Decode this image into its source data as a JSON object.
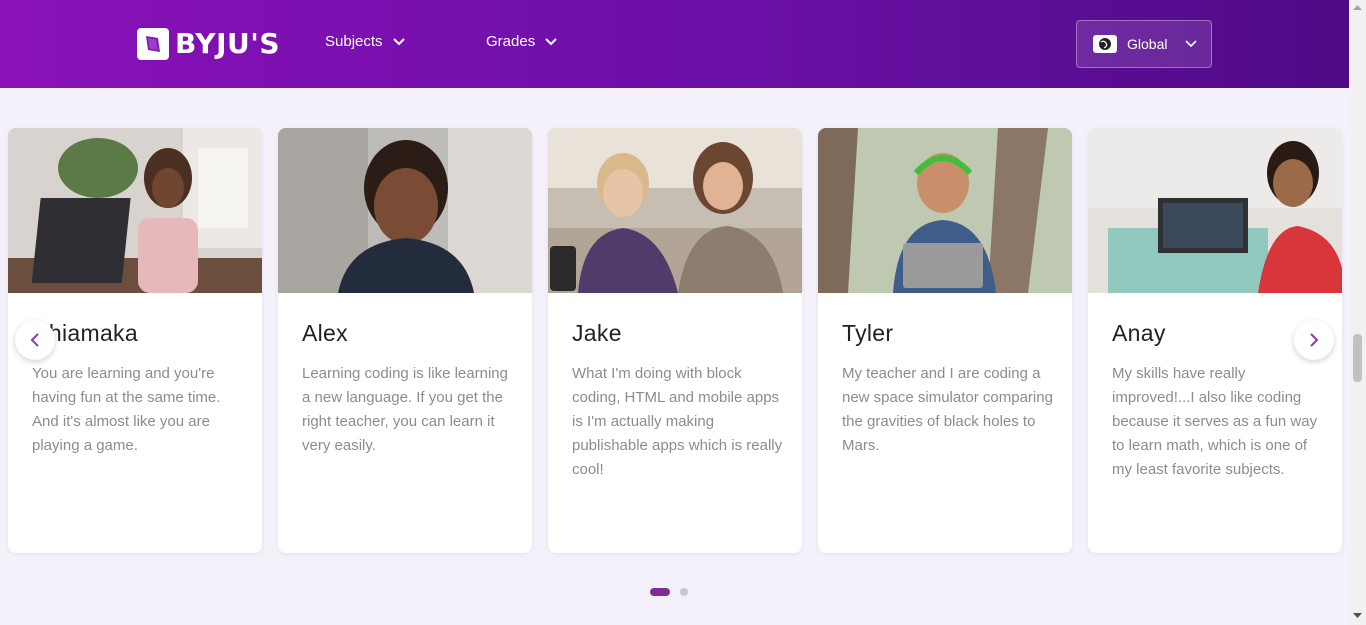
{
  "header": {
    "logo_text": "BYJU'S",
    "nav": [
      {
        "label": "Subjects"
      },
      {
        "label": "Grades"
      }
    ],
    "region": {
      "label": "Global"
    }
  },
  "testimonials": [
    {
      "name": "Chiamaka",
      "quote": "You are learning and you're having fun at the same time. And it's almost like you are playing a game."
    },
    {
      "name": "Alex",
      "quote": "Learning coding is like learning a new language. If you get the right teacher, you can learn it very easily."
    },
    {
      "name": "Jake",
      "quote": "What I'm doing with block coding, HTML and mobile apps is I'm actually making publishable apps which is really cool!"
    },
    {
      "name": "Tyler",
      "quote": "My teacher and I are coding a new space simulator comparing the gravities of black holes to Mars."
    },
    {
      "name": "Anay",
      "quote": "My skills have really improved!...I also like coding because it serves as a fun way to learn math, which is one of my least favorite subjects."
    }
  ],
  "carousel": {
    "pages": 2,
    "active_page": 1
  },
  "colors": {
    "brand_purple": "#7b1fa2",
    "dot_active": "#7b2d96",
    "dot_inactive": "#c9c6d1",
    "arrow": "#8a3aa8"
  }
}
